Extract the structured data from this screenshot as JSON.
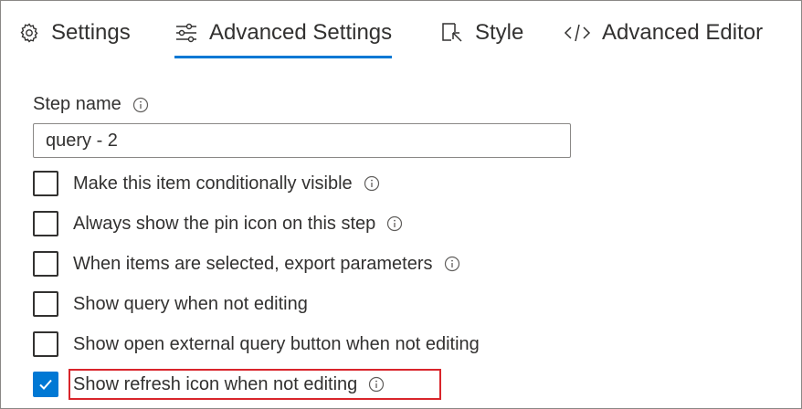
{
  "tabs": [
    {
      "label": "Settings",
      "icon": "gear-icon",
      "active": false
    },
    {
      "label": "Advanced Settings",
      "icon": "sliders-icon",
      "active": true
    },
    {
      "label": "Style",
      "icon": "style-icon",
      "active": false
    },
    {
      "label": "Advanced Editor",
      "icon": "code-icon",
      "active": false
    }
  ],
  "step_name": {
    "label": "Step name",
    "value": "query - 2"
  },
  "options": [
    {
      "label": "Make this item conditionally visible",
      "checked": false,
      "info": true
    },
    {
      "label": "Always show the pin icon on this step",
      "checked": false,
      "info": true
    },
    {
      "label": "When items are selected, export parameters",
      "checked": false,
      "info": true
    },
    {
      "label": "Show query when not editing",
      "checked": false,
      "info": false
    },
    {
      "label": "Show open external query button when not editing",
      "checked": false,
      "info": false
    },
    {
      "label": "Show refresh icon when not editing",
      "checked": true,
      "info": true
    }
  ],
  "colors": {
    "accent": "#0078d4",
    "highlight": "#d9252b",
    "text": "#323130"
  }
}
